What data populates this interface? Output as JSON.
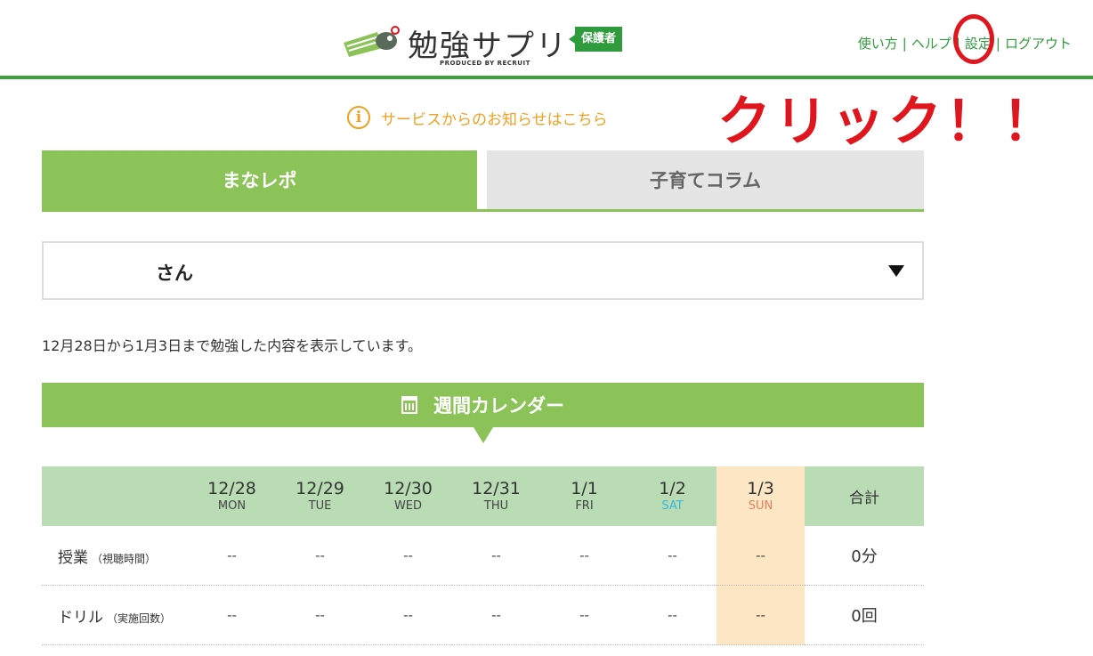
{
  "header": {
    "logo_title": "勉強サプリ",
    "logo_badge": "保護者",
    "logo_produced": "PRODUCED BY RECRUIT",
    "nav": [
      {
        "label": "使い方"
      },
      {
        "label": "ヘルプ"
      },
      {
        "label": "設定"
      },
      {
        "label": "ログアウト"
      }
    ]
  },
  "annotation": "クリック！！",
  "notice": {
    "icon": "info-icon",
    "text": "サービスからのお知らせはこちら"
  },
  "tabs": [
    {
      "label": "まなレポ",
      "active": true
    },
    {
      "label": "子育てコラム",
      "active": false
    }
  ],
  "child_select": {
    "value": "さん"
  },
  "range_text": "12月28日から1月3日まで勉強した内容を表示しています。",
  "calendar": {
    "title": "週間カレンダー",
    "days": [
      {
        "date": "12/28",
        "weekday": "MON"
      },
      {
        "date": "12/29",
        "weekday": "TUE"
      },
      {
        "date": "12/30",
        "weekday": "WED"
      },
      {
        "date": "12/31",
        "weekday": "THU"
      },
      {
        "date": "1/1",
        "weekday": "FRI"
      },
      {
        "date": "1/2",
        "weekday": "SAT"
      },
      {
        "date": "1/3",
        "weekday": "SUN"
      }
    ],
    "total_header": "合計",
    "rows": [
      {
        "label": "授業",
        "sub": "（視聴時間）",
        "values": [
          "--",
          "--",
          "--",
          "--",
          "--",
          "--",
          "--"
        ],
        "total": "0分"
      },
      {
        "label": "ドリル",
        "sub": "（実施回数）",
        "values": [
          "--",
          "--",
          "--",
          "--",
          "--",
          "--",
          "--"
        ],
        "total": "0回"
      }
    ]
  },
  "colors": {
    "brand_green": "#2f9b3c",
    "tab_green": "#8cc358",
    "notice_orange": "#f0a020",
    "annotation_red": "#e0161e",
    "sunday_bg": "#fde6c4"
  }
}
